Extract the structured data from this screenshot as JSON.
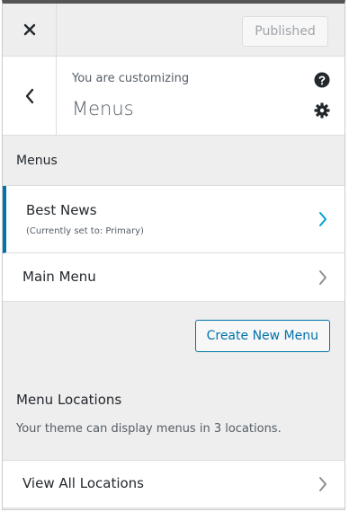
{
  "topbar": {
    "close_icon": "close-icon",
    "publish_label": "Published"
  },
  "header": {
    "back_icon": "chevron-left-icon",
    "customizing_label": "You are customizing",
    "title": "Menus",
    "help_icon": "help-icon",
    "settings_icon": "gear-icon"
  },
  "section": {
    "title": "Menus"
  },
  "menus": [
    {
      "label": "Best News",
      "sub": "(Currently set to: Primary)",
      "active": true
    },
    {
      "label": "Main Menu",
      "sub": "",
      "active": false
    }
  ],
  "create_button": "Create New Menu",
  "locations": {
    "title": "Menu Locations",
    "description": "Your theme can display menus in 3 locations.",
    "view_all": "View All Locations"
  },
  "colors": {
    "accent": "#0073aa",
    "active_chevron": "#00a0d2",
    "chevron": "#8c8f94"
  }
}
